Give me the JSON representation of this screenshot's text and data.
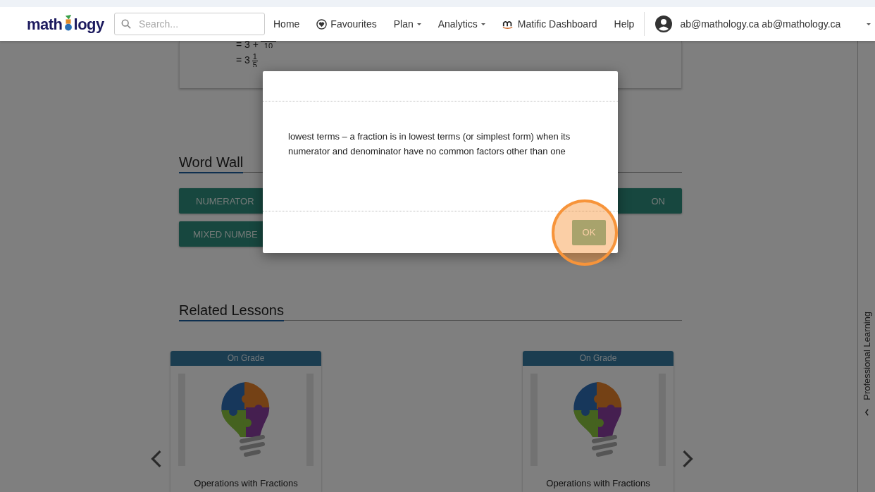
{
  "top_bar": {
    "logo": {
      "before": "math",
      "after": "logy"
    },
    "search": {
      "placeholder": "Search..."
    },
    "nav": [
      {
        "label": "Home",
        "kind": "link"
      },
      {
        "label": "Favourites",
        "kind": "favourites"
      },
      {
        "label": "Plan",
        "kind": "dropdown"
      },
      {
        "label": "Analytics",
        "kind": "dropdown"
      },
      {
        "label": "Matific Dashboard",
        "kind": "matific"
      },
      {
        "label": "Help",
        "kind": "link"
      }
    ],
    "user": {
      "name": "ab@mathology.ca ab@mathology.ca"
    }
  },
  "math_card": {
    "lines": [
      {
        "lead": "= 3 +",
        "denominator": "10"
      },
      {
        "lead": "= 3",
        "numerator": "1",
        "denominator": "5"
      }
    ]
  },
  "word_wall": {
    "title": "Word Wall",
    "rows": [
      [
        {
          "kind": "word",
          "label": "NUMERATOR"
        },
        {
          "kind": "spacer"
        },
        {
          "kind": "word_end",
          "label": "ON"
        }
      ],
      [
        {
          "kind": "word",
          "label": "MIXED NUMBE"
        },
        {
          "kind": "covered"
        },
        {
          "kind": "covered"
        }
      ]
    ]
  },
  "related_lessons": {
    "title": "Related Lessons",
    "cards": [
      {
        "badge": "On Grade",
        "title": "Operations with Fractions"
      },
      {
        "badge": "On Grade",
        "title": "Operations with Fractions"
      }
    ]
  },
  "side_tab": {
    "label": "Professional Learning"
  },
  "dialog": {
    "text": "lowest terms – a fraction is in lowest terms (or simplest form) when its numerator and denominator have no common factors other than one",
    "buttons": [
      {
        "label": "OK",
        "highlighted": true
      }
    ]
  }
}
